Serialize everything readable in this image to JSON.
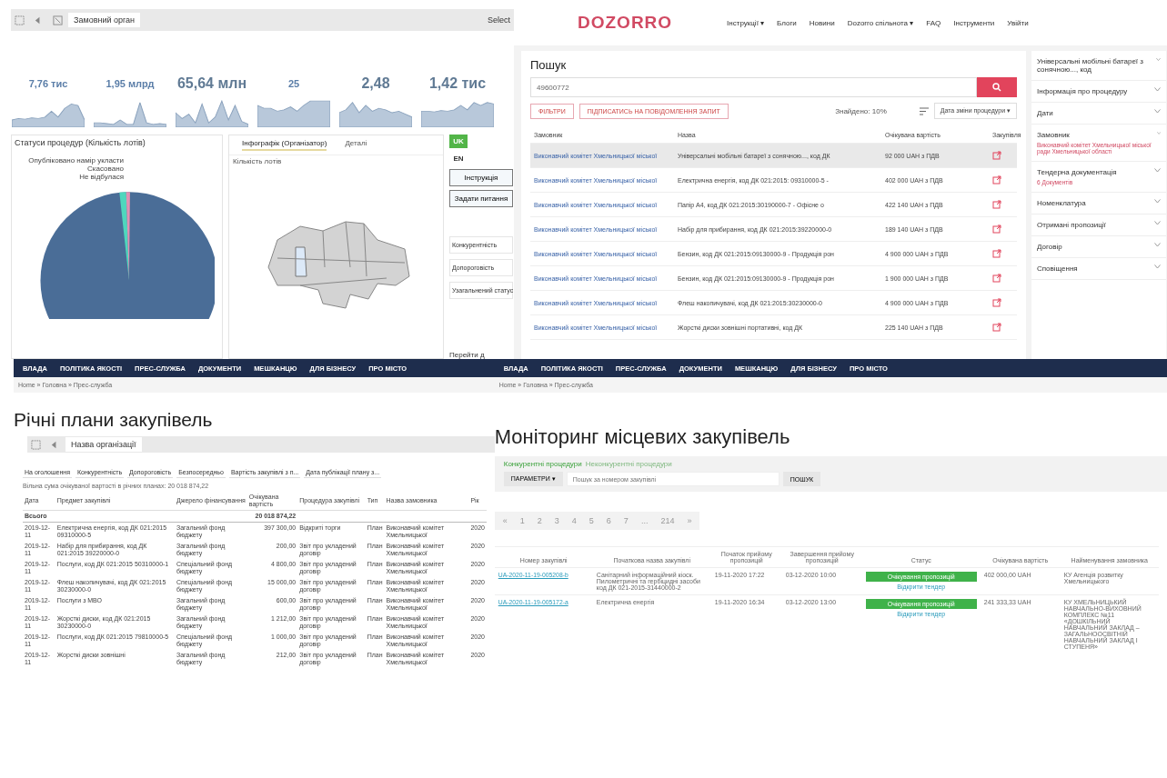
{
  "qlik_dashboard": {
    "toolbar": {
      "selection": "Замовний орган",
      "right_label": "Select"
    },
    "kpis": [
      {
        "value": "7,76 тис",
        "kind": "small"
      },
      {
        "value": "1,95 млрд",
        "kind": "small"
      },
      {
        "value": "65,64 млн",
        "kind": "large"
      },
      {
        "value": "25",
        "kind": "small"
      },
      {
        "value": "2,48",
        "kind": "large"
      },
      {
        "value": "1,42 тис",
        "kind": "large"
      }
    ],
    "pie": {
      "title": "Статуси процедур (Кількість лотів)",
      "labels": [
        "Опубліковано намір укласти",
        "Скасовано",
        "Не відбулася"
      ]
    },
    "tabs": [
      {
        "label": "Інфографік (Організатор)",
        "selected": true
      },
      {
        "label": "Деталі",
        "selected": false
      }
    ],
    "map_title": "Кількість лотів",
    "languages": [
      {
        "label": "UK",
        "selected": true
      },
      {
        "label": "EN",
        "selected": false
      }
    ],
    "buttons": [
      "Інструкція",
      "Задати питання"
    ],
    "filters": [
      "Конкурентність",
      "Допороговість",
      "Узагальнений статус"
    ],
    "footer_link": "Перейти д"
  },
  "dozorro": {
    "logo": "DOZORRO",
    "nav": [
      "Інструкції ▾",
      "Блоги",
      "Новини",
      "Dozorro спільнота ▾",
      "FAQ",
      "Інструменти",
      "Увійти"
    ],
    "search_title": "Пошук",
    "search_value": "49600772",
    "filter_buttons": [
      "ФІЛЬТРИ",
      "ПІДПИСАТИСЬ НА ПОВІДОМЛЕННЯ ЗАПИТ"
    ],
    "found": "Знайдено: 10%",
    "sort": "Дата зміни процедури ▾",
    "columns": [
      "Замовник",
      "Назва",
      "Очікувана вартість",
      "Закупівля"
    ],
    "rows": [
      {
        "buyer": "Виконавчий комітет Хмельницької міської",
        "name": "Універсальні мобільні батареї з сонячною..., код ДК",
        "value": "92 000 UAH з ПДВ",
        "selected": true
      },
      {
        "buyer": "Виконавчий комітет Хмельницької міської",
        "name": "Електрична енергія, код ДК 021:2015: 09310000-5 -",
        "value": "402 000 UAH з ПДВ",
        "selected": false
      },
      {
        "buyer": "Виконавчий комітет Хмельницької міської",
        "name": "Папір А4, код ДК 021:2015:30190000-7 - Офісне о",
        "value": "422 140 UAH з ПДВ",
        "selected": false
      },
      {
        "buyer": "Виконавчий комітет Хмельницької міської",
        "name": "Набір для прибирання, код ДК 021:2015:39220000-0",
        "value": "189 140 UAH з ПДВ",
        "selected": false
      },
      {
        "buyer": "Виконавчий комітет Хмельницької міської",
        "name": "Бензин, код ДК 021:2015:09130000-9 - Продукція рон",
        "value": "4 900 000 UAH з ПДВ",
        "selected": false
      },
      {
        "buyer": "Виконавчий комітет Хмельницької міської",
        "name": "Бензин, код ДК 021:2015:09130000-9 - Продукція рон",
        "value": "1 900 000 UAH з ПДВ",
        "selected": false
      },
      {
        "buyer": "Виконавчий комітет Хмельницької міської",
        "name": "Флеш накопичувачі, код ДК 021:2015:30230000-0",
        "value": "4 900 000 UAH з ПДВ",
        "selected": false
      },
      {
        "buyer": "Виконавчий комітет Хмельницької міської",
        "name": "Жорсткі диски зовнішні портативні, код ДК",
        "value": "225 140 UAH з ПДВ",
        "selected": false
      }
    ],
    "sidebar": [
      {
        "title": "Універсальні мобільні батареї з сонячною..., код"
      },
      {
        "title": "Інформація про процедуру"
      },
      {
        "title": "Дати"
      },
      {
        "title": "Замовник",
        "note": "Виконавчий комітет Хмельницької міської ради Хмельницької області"
      },
      {
        "title": "Тендерна документація",
        "note": "6 Документів"
      },
      {
        "title": "Номенклатура"
      },
      {
        "title": "Отримані пропозиції"
      },
      {
        "title": "Договір"
      },
      {
        "title": "Сповіщення"
      }
    ]
  },
  "annual_plans": {
    "nav": [
      "ВЛАДА",
      "ПОЛІТИКА ЯКОСТІ",
      "ПРЕС-СЛУЖБА",
      "ДОКУМЕНТИ",
      "МЕШКАНЦЮ",
      "ДЛЯ БІЗНЕСУ",
      "ПРО МІСТО"
    ],
    "breadcrumb": "Home » Головна » Прес-служба",
    "title": "Річні плани закупівель",
    "selection": "Назва організації",
    "filters": [
      "На оголошення",
      "Конкурентність",
      "Допороговість",
      "Безпосередньо",
      "Вартість закупівлі з п...",
      "Дата публікації плану з..."
    ],
    "note": "Вільна сума очікуваної вартості в річних планах: 20 018 874,22",
    "columns": [
      "Дата",
      "Предмет закупівлі",
      "Джерело фінансування",
      "Очікувана вартість",
      "Процедура закупівлі",
      "Тип",
      "Назва замовника",
      "Рік"
    ],
    "total_label": "Всього",
    "total": "20 018 874,22",
    "rows": [
      {
        "date": "2019-12-11",
        "subject": "Електрична енергія, код ДК 021:2015 09310000-5",
        "fund": "Загальний фонд бюджету",
        "sum": "397 300,00",
        "procedure": "Відкриті торги",
        "type": "План",
        "buyer": "Виконавчий комітет Хмельницької",
        "year": "2020"
      },
      {
        "date": "2019-12-11",
        "subject": "Набір для прибирання, код ДК 021:2015 39220000-0",
        "fund": "Загальний фонд бюджету",
        "sum": "200,00",
        "procedure": "Звіт про укладений договір",
        "type": "План",
        "buyer": "Виконавчий комітет Хмельницької",
        "year": "2020"
      },
      {
        "date": "2019-12-11",
        "subject": "Послуги, код ДК 021:2015 50310000-1",
        "fund": "Спеціальний фонд бюджету",
        "sum": "4 800,00",
        "procedure": "Звіт про укладений договір",
        "type": "План",
        "buyer": "Виконавчий комітет Хмельницької",
        "year": "2020"
      },
      {
        "date": "2019-12-11",
        "subject": "Флеш накопичувачі, код ДК 021:2015 30230000-0",
        "fund": "Спеціальний фонд бюджету",
        "sum": "15 000,00",
        "procedure": "Звіт про укладений договір",
        "type": "План",
        "buyer": "Виконавчий комітет Хмельницької",
        "year": "2020"
      },
      {
        "date": "2019-12-11",
        "subject": "Послуги з МВО",
        "fund": "Загальний фонд бюджету",
        "sum": "600,00",
        "procedure": "Звіт про укладений договір",
        "type": "План",
        "buyer": "Виконавчий комітет Хмельницької",
        "year": "2020"
      },
      {
        "date": "2019-12-11",
        "subject": "Жорсткі диски, код ДК 021:2015 30230000-0",
        "fund": "Загальний фонд бюджету",
        "sum": "1 212,00",
        "procedure": "Звіт про укладений договір",
        "type": "План",
        "buyer": "Виконавчий комітет Хмельницької",
        "year": "2020"
      },
      {
        "date": "2019-12-11",
        "subject": "Послуги, код ДК 021:2015 79810000-5",
        "fund": "Спеціальний фонд бюджету",
        "sum": "1 000,00",
        "procedure": "Звіт про укладений договір",
        "type": "План",
        "buyer": "Виконавчий комітет Хмельницької",
        "year": "2020"
      },
      {
        "date": "2019-12-11",
        "subject": "Жорсткі диски зовнішні",
        "fund": "Загальний фонд бюджету",
        "sum": "212,00",
        "procedure": "Звіт про укладений договір",
        "type": "План",
        "buyer": "Виконавчий комітет Хмельницької",
        "year": "2020"
      }
    ]
  },
  "monitoring": {
    "nav": [
      "ВЛАДА",
      "ПОЛІТИКА ЯКОСТІ",
      "ПРЕС-СЛУЖБА",
      "ДОКУМЕНТИ",
      "МЕШКАНЦЮ",
      "ДЛЯ БІЗНЕСУ",
      "ПРО МІСТО"
    ],
    "breadcrumb": "Home » Головна » Прес-служба",
    "title": "Моніторинг місцевих закупівель",
    "procedure_links": [
      {
        "label": "Конкурентні процедури",
        "selected": true
      },
      {
        "label": "Неконкурентні процедури",
        "selected": false
      }
    ],
    "params_button": "ПАРАМЕТРИ ▾",
    "search_placeholder": "Пошук за номером закупівлі",
    "search_button": "ПОШУК",
    "pages": [
      "«",
      "1",
      "2",
      "3",
      "4",
      "5",
      "6",
      "7",
      "...",
      "214",
      "»"
    ],
    "columns": [
      "Номер закупівлі",
      "Початкова назва закупівлі",
      "Початок прийому пропозицій",
      "Завершення прийому пропозицій",
      "Статус",
      "Очікувана вартість",
      "Найменування замовника"
    ],
    "rows": [
      {
        "id": "UA-2020-11-19-005208-b",
        "name": "Санітарний інформаційний кіоск. Пилометричні та гербіцидні засоби код ДК 021-2015-31440000-2",
        "start": "19-11-2020 17:22",
        "end": "03-12-2020 10:00",
        "status": "Очікування пропозицій",
        "open": "Відкрити тендер",
        "value": "402 000,00 UAH",
        "buyer": "КУ Агенція розвитку Хмельницького"
      },
      {
        "id": "UA-2020-11-19-005172-a",
        "name": "Електрична енергія",
        "start": "19-11-2020 16:34",
        "end": "03-12-2020 13:00",
        "status": "Очікування пропозицій",
        "open": "Відкрити тендер",
        "value": "241 333,33 UAH",
        "buyer": "КУ ХМЕЛЬНИЦЬКИЙ НАВЧАЛЬНО-ВИХОВНИЙ КОМПЛЕКС №11 «ДОШКІЛЬНИЙ НАВЧАЛЬНИЙ ЗАКЛАД – ЗАГАЛЬНООСВІТНІЙ НАВЧАЛЬНИЙ ЗАКЛАД І СТУПЕНЯ»"
      }
    ]
  }
}
